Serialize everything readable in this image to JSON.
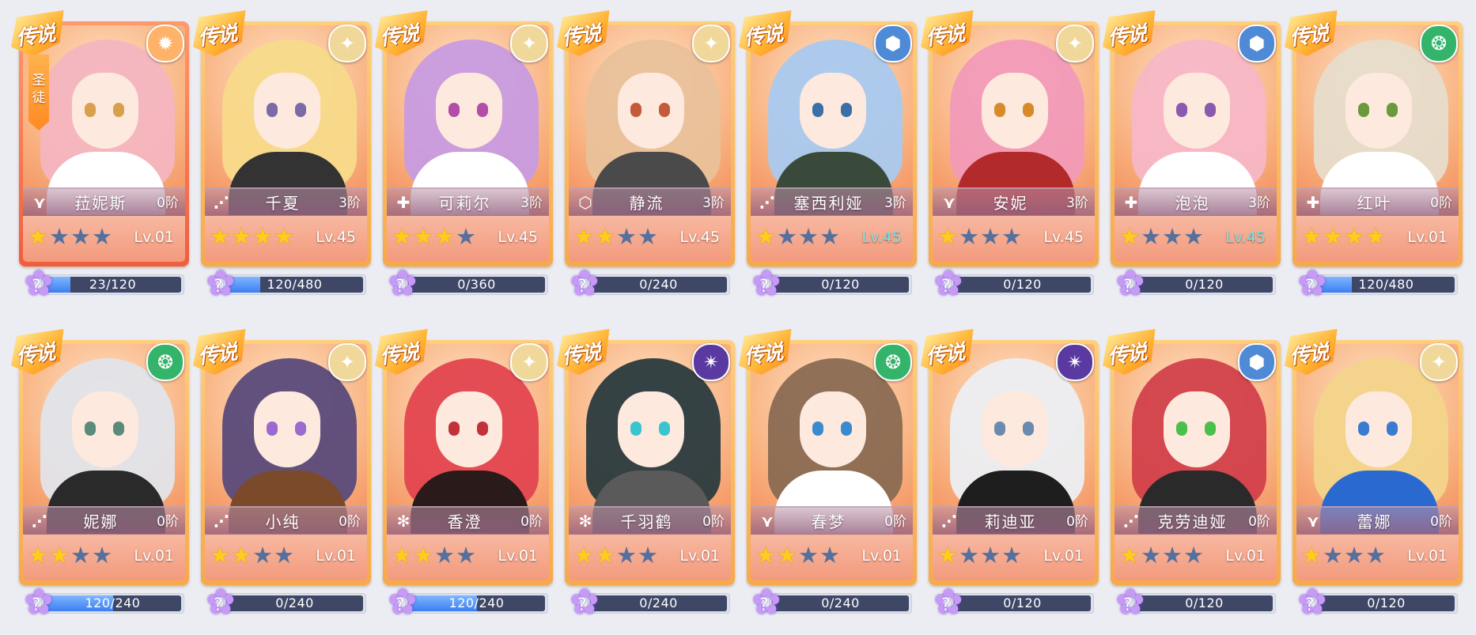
{
  "legend_label": "传说",
  "saint_label": "圣徒",
  "cards": [
    {
      "name": "菈妮斯",
      "rank": "0阶",
      "level": "Lv.01",
      "stars": 1,
      "max_stars": 4,
      "role": "wing",
      "element": "holy-burst",
      "xp": "23/120",
      "xp_progress": 0.19,
      "selected": true,
      "saint": true,
      "hair": "#f4b5c0",
      "eyes": "#d8a04a",
      "outfit": "#ffffff",
      "level_color": "#ffffff"
    },
    {
      "name": "千夏",
      "rank": "3阶",
      "level": "Lv.45",
      "stars": 4,
      "max_stars": 4,
      "role": "lance",
      "element": "holy",
      "xp": "120/480",
      "xp_progress": 0.25,
      "selected": false,
      "saint": false,
      "hair": "#f8da8a",
      "eyes": "#7a6aa8",
      "outfit": "#333333",
      "level_color": "#ffffff"
    },
    {
      "name": "可莉尔",
      "rank": "3阶",
      "level": "Lv.45",
      "stars": 3,
      "max_stars": 4,
      "role": "cross",
      "element": "holy",
      "xp": "0/360",
      "xp_progress": 0,
      "selected": false,
      "saint": false,
      "hair": "#c89be0",
      "eyes": "#b24da8",
      "outfit": "#ffffff",
      "level_color": "#ffffff"
    },
    {
      "name": "静流",
      "rank": "3阶",
      "level": "Lv.45",
      "stars": 2,
      "max_stars": 4,
      "role": "hex",
      "element": "holy",
      "xp": "0/240",
      "xp_progress": 0,
      "selected": false,
      "saint": false,
      "hair": "#e9c19a",
      "eyes": "#c45a3a",
      "outfit": "#4a4a4a",
      "level_color": "#ffffff"
    },
    {
      "name": "塞西利娅",
      "rank": "3阶",
      "level": "Lv.45",
      "stars": 1,
      "max_stars": 4,
      "role": "lance",
      "element": "hex-gold",
      "xp": "0/120",
      "xp_progress": 0,
      "selected": false,
      "saint": false,
      "hair": "#a9c9ef",
      "eyes": "#3b6fa8",
      "outfit": "#3a4a3a",
      "level_color": "#78e6e8"
    },
    {
      "name": "安妮",
      "rank": "3阶",
      "level": "Lv.45",
      "stars": 1,
      "max_stars": 4,
      "role": "wing",
      "element": "holy",
      "xp": "0/120",
      "xp_progress": 0,
      "selected": false,
      "saint": false,
      "hair": "#f29ab8",
      "eyes": "#d88a2a",
      "outfit": "#b22a2a",
      "level_color": "#ffffff"
    },
    {
      "name": "泡泡",
      "rank": "3阶",
      "level": "Lv.45",
      "stars": 1,
      "max_stars": 4,
      "role": "cross",
      "element": "hex-gold",
      "xp": "0/120",
      "xp_progress": 0,
      "selected": false,
      "saint": false,
      "hair": "#f7b7c6",
      "eyes": "#8a5ab0",
      "outfit": "#ffffff",
      "level_color": "#78e6e8"
    },
    {
      "name": "红叶",
      "rank": "0阶",
      "level": "Lv.01",
      "stars": 4,
      "max_stars": 4,
      "role": "cross",
      "element": "wind",
      "xp": "120/480",
      "xp_progress": 0.25,
      "selected": false,
      "saint": false,
      "hair": "#e7dccb",
      "eyes": "#6a9a3a",
      "outfit": "#ffffff",
      "level_color": "#ffffff"
    },
    {
      "name": "妮娜",
      "rank": "0阶",
      "level": "Lv.01",
      "stars": 2,
      "max_stars": 4,
      "role": "lance",
      "element": "wind",
      "xp": "120/240",
      "xp_progress": 0.5,
      "selected": false,
      "saint": false,
      "hair": "#e1e4ea",
      "eyes": "#5a8a7a",
      "outfit": "#2a2a2a",
      "level_color": "#ffffff"
    },
    {
      "name": "小纯",
      "rank": "0阶",
      "level": "Lv.01",
      "stars": 2,
      "max_stars": 4,
      "role": "lance",
      "element": "holy",
      "xp": "0/240",
      "xp_progress": 0,
      "selected": false,
      "saint": false,
      "hair": "#5a4a7a",
      "eyes": "#9a6ad0",
      "outfit": "#7a4a2a",
      "level_color": "#ffffff"
    },
    {
      "name": "香澄",
      "rank": "0阶",
      "level": "Lv.01",
      "stars": 2,
      "max_stars": 4,
      "role": "spark",
      "element": "holy",
      "xp": "120/240",
      "xp_progress": 0.5,
      "selected": false,
      "saint": false,
      "hair": "#e3454f",
      "eyes": "#c2303a",
      "outfit": "#2a1a1a",
      "level_color": "#ffffff"
    },
    {
      "name": "千羽鹤",
      "rank": "0阶",
      "level": "Lv.01",
      "stars": 2,
      "max_stars": 4,
      "role": "spark",
      "element": "dark",
      "xp": "0/240",
      "xp_progress": 0,
      "selected": false,
      "saint": false,
      "hair": "#2a3a3e",
      "eyes": "#3ac4d0",
      "outfit": "#5a5a5a",
      "level_color": "#ffffff"
    },
    {
      "name": "春梦",
      "rank": "0阶",
      "level": "Lv.01",
      "stars": 2,
      "max_stars": 4,
      "role": "wing",
      "element": "wind",
      "xp": "0/240",
      "xp_progress": 0,
      "selected": false,
      "saint": false,
      "hair": "#8a6a52",
      "eyes": "#3a8ad0",
      "outfit": "#ffffff",
      "level_color": "#ffffff"
    },
    {
      "name": "莉迪亚",
      "rank": "0阶",
      "level": "Lv.01",
      "stars": 1,
      "max_stars": 4,
      "role": "lance",
      "element": "dark",
      "xp": "0/120",
      "xp_progress": 0,
      "selected": false,
      "saint": false,
      "hair": "#eceef2",
      "eyes": "#6a8ab0",
      "outfit": "#1e1e1e",
      "level_color": "#ffffff"
    },
    {
      "name": "克劳迪娅",
      "rank": "0阶",
      "level": "Lv.01",
      "stars": 1,
      "max_stars": 4,
      "role": "lance",
      "element": "hex-gold",
      "xp": "0/120",
      "xp_progress": 0,
      "selected": false,
      "saint": false,
      "hair": "#d2404a",
      "eyes": "#4ac04a",
      "outfit": "#2a2a2a",
      "level_color": "#ffffff"
    },
    {
      "name": "蕾娜",
      "rank": "0阶",
      "level": "Lv.01",
      "stars": 1,
      "max_stars": 4,
      "role": "wing",
      "element": "holy",
      "xp": "0/120",
      "xp_progress": 0,
      "selected": false,
      "saint": false,
      "hair": "#f3d48a",
      "eyes": "#3a7ad0",
      "outfit": "#2a6ad0",
      "level_color": "#ffffff"
    }
  ],
  "role_glyphs": {
    "wing": "⋎",
    "lance": "⋰",
    "cross": "✚",
    "hex": "⬡",
    "spark": "✻"
  },
  "element_styles": {
    "holy": {
      "glyph": "✦",
      "bg": "#f0d79a"
    },
    "holy-burst": {
      "glyph": "✹",
      "bg": "#ffb36a"
    },
    "hex-gold": {
      "glyph": "⬢",
      "bg": "#4f8ad6"
    },
    "wind": {
      "glyph": "❂",
      "bg": "#33b46a"
    },
    "dark": {
      "glyph": "✴",
      "bg": "#5a3aa0"
    }
  }
}
